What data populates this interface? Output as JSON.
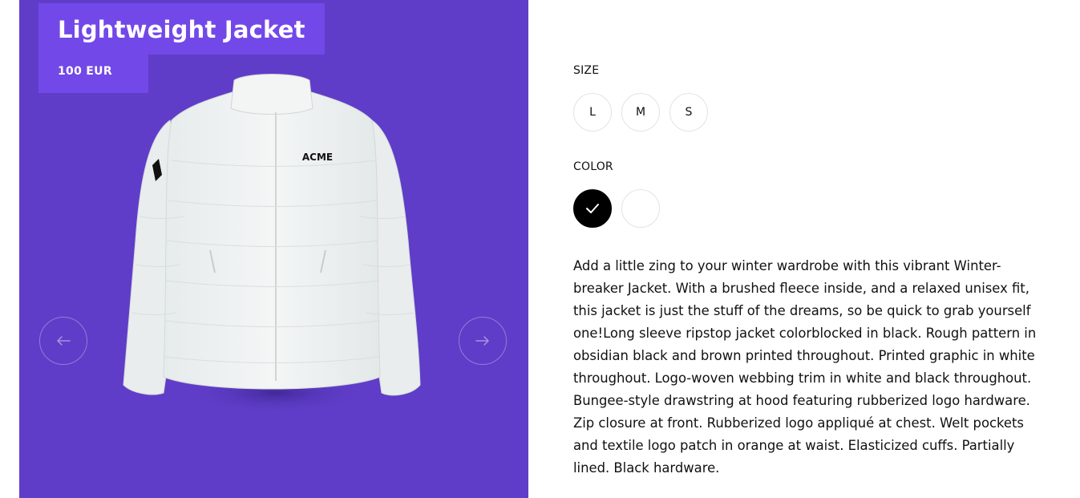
{
  "product": {
    "title": "Lightweight Jacket",
    "price": "100 EUR",
    "image_logo_text": "ACME",
    "gallery_background": "#5f3dc8",
    "badge_color": "#7348e8"
  },
  "gallery": {
    "prev_icon": "arrow-left-icon",
    "next_icon": "arrow-right-icon"
  },
  "size": {
    "label": "SIZE",
    "options": [
      "L",
      "M",
      "S"
    ]
  },
  "color": {
    "label": "COLOR",
    "options": [
      {
        "name": "black",
        "hex": "#000000",
        "selected": true
      },
      {
        "name": "white",
        "hex": "#ffffff",
        "selected": false
      }
    ]
  },
  "description": "Add a little zing to your winter wardrobe with this vibrant Winter-breaker Jacket. With a brushed fleece inside, and a relaxed unisex fit, this jacket is just the stuff of the dreams, so be quick to grab yourself one!Long sleeve ripstop jacket colorblocked in black. Rough pattern in obsidian black and brown printed throughout. Printed graphic in white throughout. Logo-woven webbing trim in white and black throughout. Bungee-style drawstring at hood featuring rubberized logo hardware. Zip closure at front. Rubberized logo appliqué at chest. Welt pockets and textile logo patch in orange at waist. Elasticized cuffs. Partially lined. Black hardware."
}
